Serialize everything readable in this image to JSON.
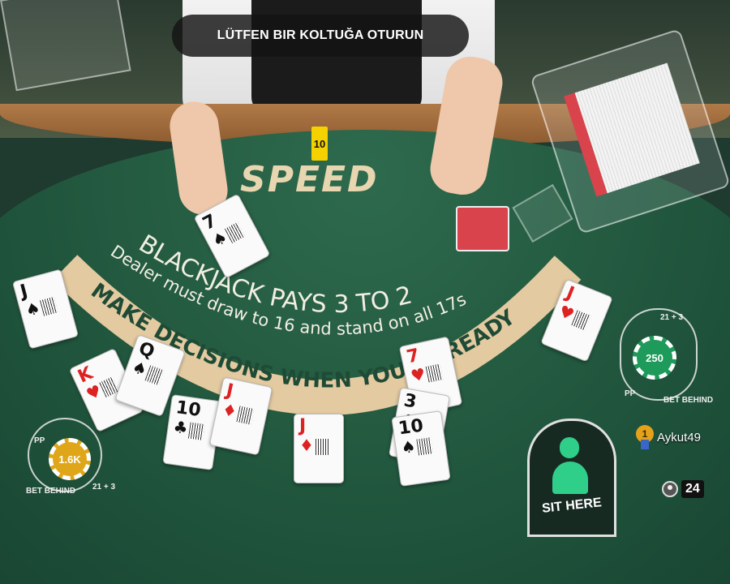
{
  "banner": {
    "text": "LÜTFEN BIR KOLTUĞA OTURUN"
  },
  "timer": {
    "value": "10"
  },
  "table": {
    "logo": "SPEED",
    "payout_text": "BLACKJACK PAYS 3 TO 2",
    "rule_text": "Dealer must draw to 16 and stand on all 17s",
    "banner_arc_text": "MAKE DECISIONS WHEN YOU'RE READY"
  },
  "cards": [
    {
      "rank": "J",
      "suit": "♠",
      "color": "black"
    },
    {
      "rank": "K",
      "suit": "♥",
      "color": "red"
    },
    {
      "rank": "Q",
      "suit": "♠",
      "color": "black"
    },
    {
      "rank": "10",
      "suit": "♣",
      "color": "black"
    },
    {
      "rank": "J",
      "suit": "♦",
      "color": "red"
    },
    {
      "rank": "J",
      "suit": "♦",
      "color": "red"
    },
    {
      "rank": "7",
      "suit": "♥",
      "color": "red"
    },
    {
      "rank": "3",
      "suit": "♣",
      "color": "black"
    },
    {
      "rank": "10",
      "suit": "♠",
      "color": "black"
    },
    {
      "rank": "J",
      "suit": "♥",
      "color": "red"
    },
    {
      "rank": "7",
      "suit": "♠",
      "color": "black"
    }
  ],
  "seats": {
    "left": {
      "chip": "1.6K",
      "pp": "PP",
      "bet_behind": "BET BEHIND",
      "side": "21 + 3"
    },
    "right": {
      "chip": "250",
      "pp": "PP",
      "bet_behind": "BET BEHIND",
      "side": "21 + 3"
    }
  },
  "sit_here": {
    "label": "SIT HERE"
  },
  "player": {
    "rank": "1",
    "name": "Aykut49"
  },
  "viewers": {
    "count": "24"
  },
  "colors": {
    "felt": "#235a40",
    "accent": "#2fcf8a",
    "timer": "#f5d100"
  }
}
